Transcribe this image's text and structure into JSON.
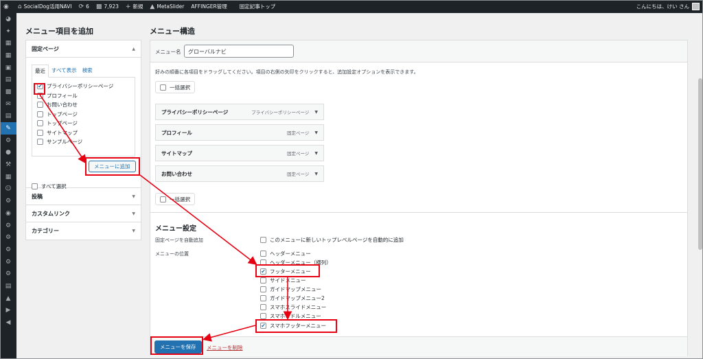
{
  "admin_bar": {
    "site_name": "SocialDog活用NAVI",
    "updates_count": "6",
    "comments_count": "7,923",
    "new_label": "新規",
    "metaslider_label": "MetaSlider",
    "affinger_label": "AFFINGER管理",
    "fixed_article_label": "固定記事トップ",
    "greeting": "こんにちは、けい さん"
  },
  "left_panel": {
    "heading": "メニュー項目を追加",
    "fixed_pages_title": "固定ページ",
    "tabs": [
      "最近",
      "すべて表示",
      "検索"
    ],
    "pages": [
      {
        "label": "プライバシーポリシーページ",
        "checked": true
      },
      {
        "label": "プロフィール",
        "checked": false
      },
      {
        "label": "お問い合わせ",
        "checked": false
      },
      {
        "label": "トップページ",
        "checked": false
      },
      {
        "label": "トップページ",
        "checked": false
      },
      {
        "label": "サイトマップ",
        "checked": false
      },
      {
        "label": "サンプルページ",
        "checked": false
      }
    ],
    "select_all_label": "すべて選択",
    "add_button_label": "メニューに追加",
    "posts_title": "投稿",
    "custom_link_title": "カスタムリンク",
    "category_title": "カテゴリー"
  },
  "right_panel": {
    "heading": "メニュー構造",
    "menu_name_label": "メニュー名",
    "menu_name_value": "グローバルナビ",
    "instructions": "好みの順番に各項目をドラッグしてください。項目の右側の矢印をクリックすると、追加設定オプションを表示できます。",
    "bulk_select_label": "一括選択",
    "menu_items": [
      {
        "title": "プライバシーポリシーページ",
        "type": "プライバシーポリシーページ"
      },
      {
        "title": "プロフィール",
        "type": "固定ページ"
      },
      {
        "title": "サイトマップ",
        "type": "固定ページ"
      },
      {
        "title": "お問い合わせ",
        "type": "固定ページ"
      }
    ],
    "settings_heading": "メニュー設定",
    "auto_add_label": "固定ページを自動追加",
    "auto_add_option": "このメニューに新しいトップレベルページを自動的に追加",
    "locations_label": "メニューの位置",
    "locations": [
      {
        "label": "ヘッダーメニュー",
        "checked": false
      },
      {
        "label": "ヘッダーメニュー（横列）",
        "checked": false
      },
      {
        "label": "フッターメニュー",
        "checked": true
      },
      {
        "label": "サイドメニュー",
        "checked": false
      },
      {
        "label": "ガイドマップメニュー",
        "checked": false
      },
      {
        "label": "ガイドマップメニュー2",
        "checked": false
      },
      {
        "label": "スマホスライドメニュー",
        "checked": false
      },
      {
        "label": "スマホミドルメニュー",
        "checked": false
      },
      {
        "label": "スマホフッターメニュー",
        "checked": true
      }
    ],
    "save_button_label": "メニューを保存",
    "delete_link_label": "メニューを削除"
  },
  "colors": {
    "accent": "#2271b1",
    "admin_bar": "#1d2327",
    "annotation": "#e60012"
  }
}
